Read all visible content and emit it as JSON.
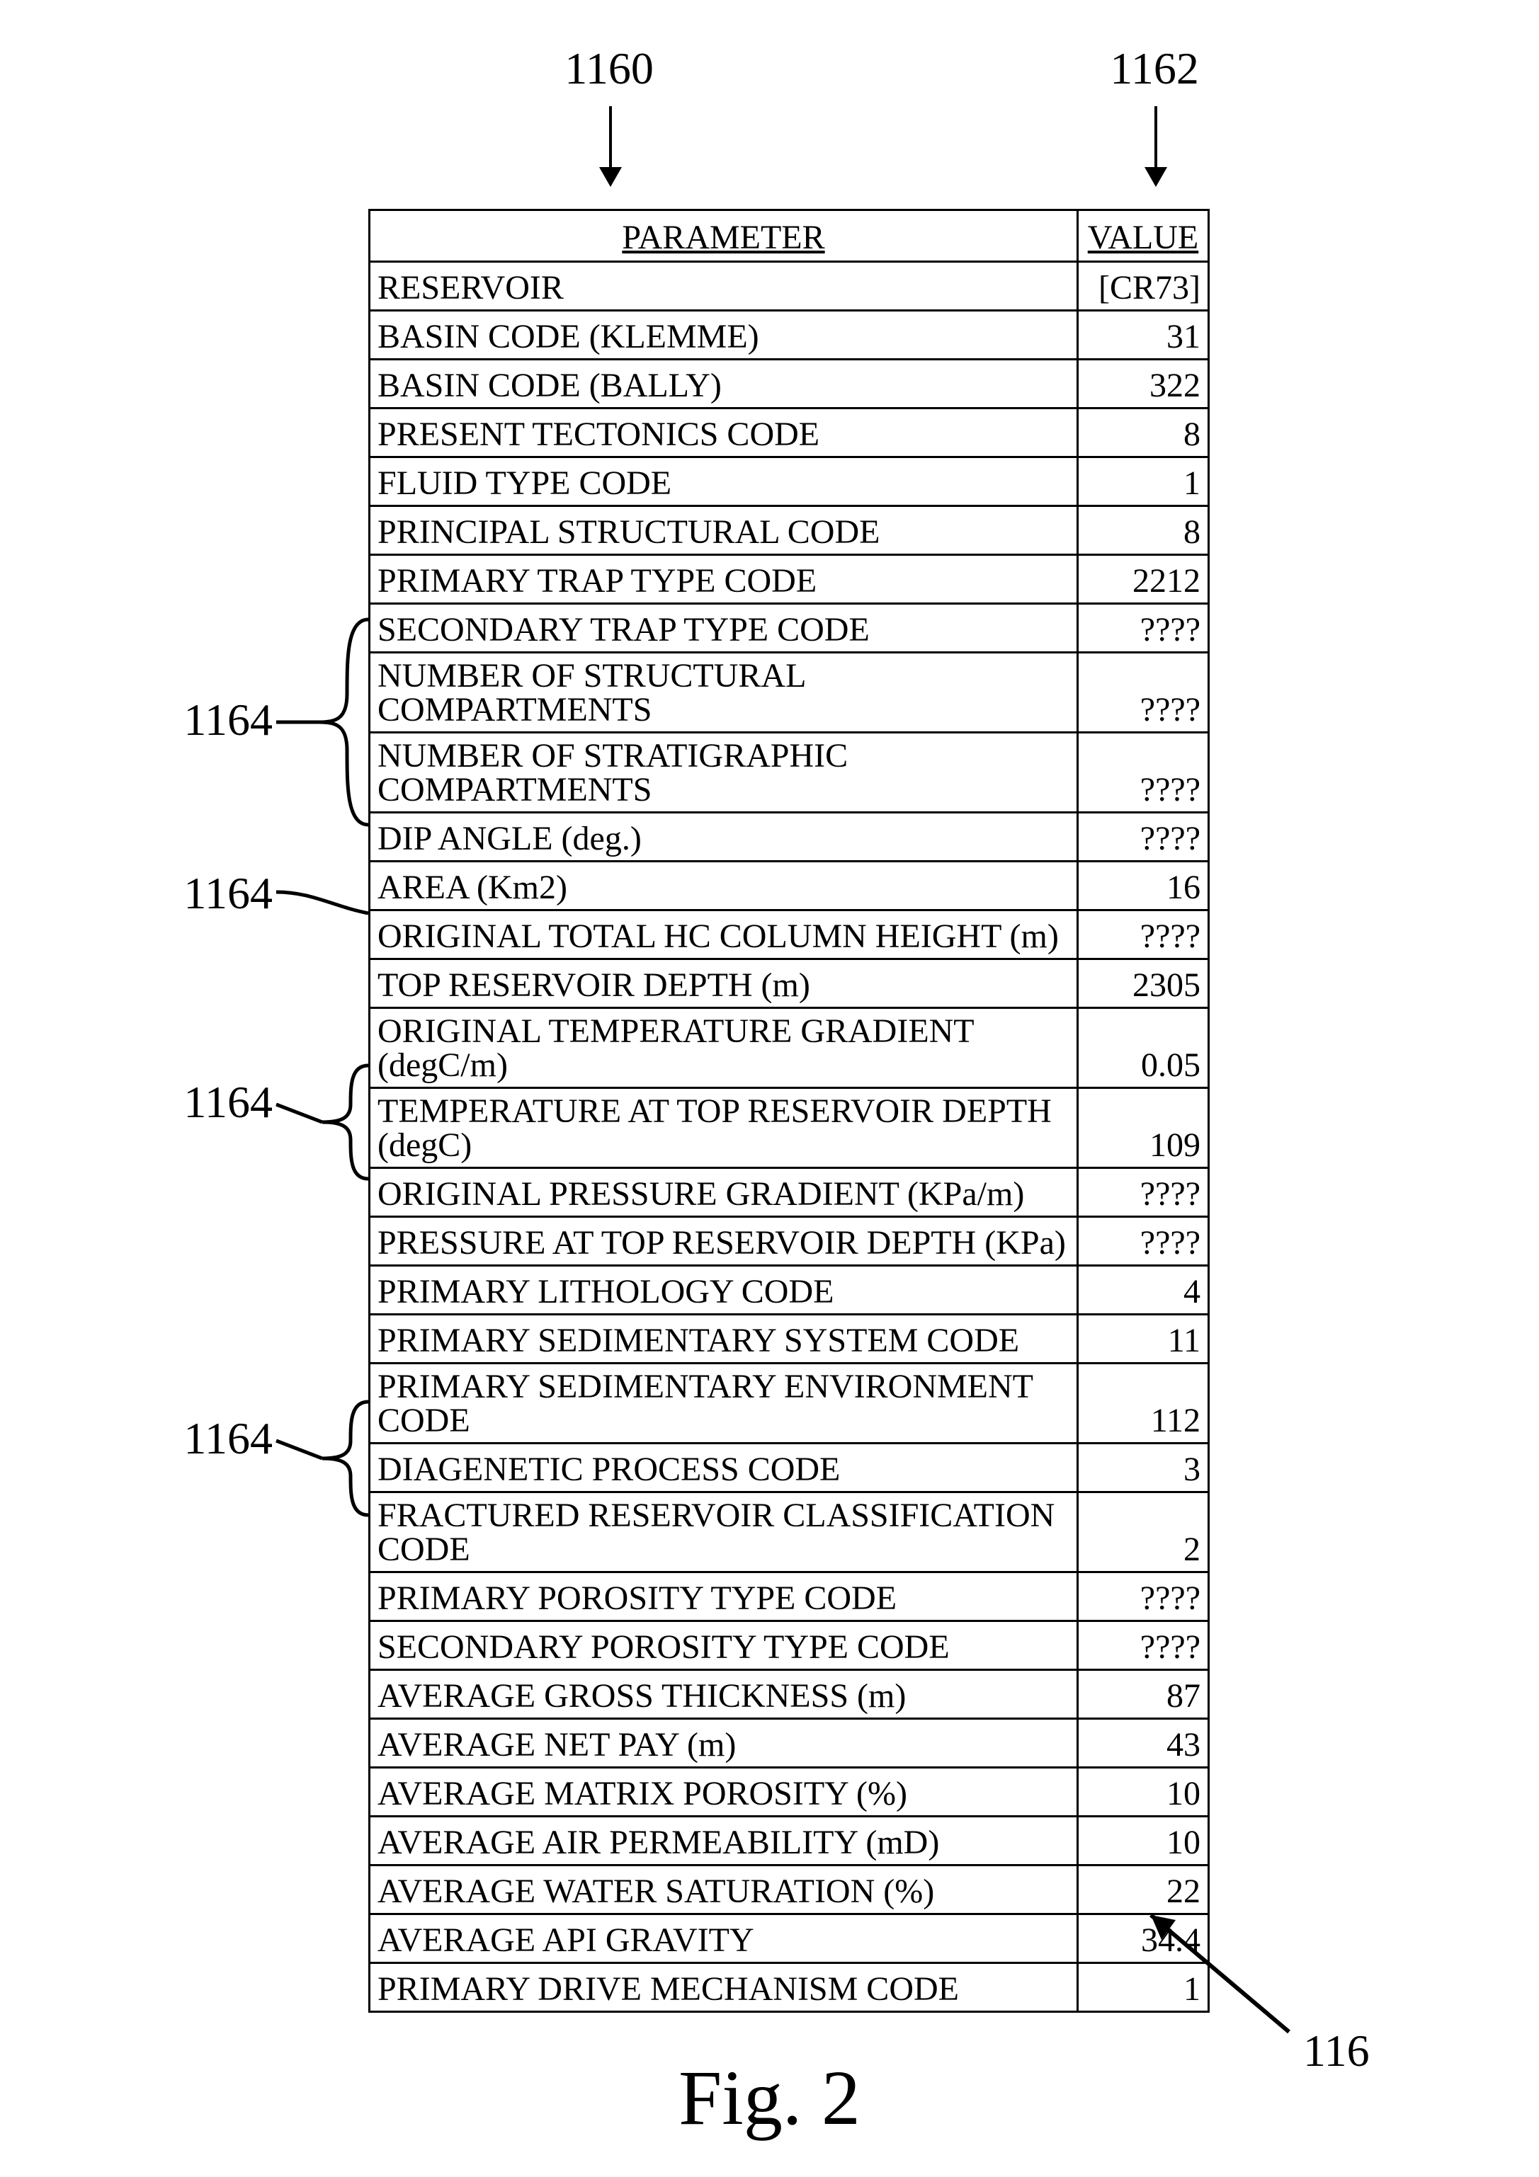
{
  "labels": {
    "col_param_pointer": "1160",
    "col_value_pointer": "1162",
    "row_pointer": "1164",
    "figure_pointer": "116",
    "figure_caption": "Fig. 2"
  },
  "headers": {
    "parameter": "PARAMETER",
    "value": "VALUE"
  },
  "rows": [
    {
      "parameter": "RESERVOIR",
      "value": "[CR73]"
    },
    {
      "parameter": "BASIN CODE (KLEMME)",
      "value": "31"
    },
    {
      "parameter": "BASIN CODE (BALLY)",
      "value": "322"
    },
    {
      "parameter": "PRESENT TECTONICS CODE",
      "value": "8"
    },
    {
      "parameter": "FLUID TYPE CODE",
      "value": "1"
    },
    {
      "parameter": "PRINCIPAL STRUCTURAL CODE",
      "value": "8"
    },
    {
      "parameter": "PRIMARY TRAP TYPE CODE",
      "value": "2212"
    },
    {
      "parameter": "SECONDARY TRAP TYPE CODE",
      "value": "????"
    },
    {
      "parameter": "NUMBER OF STRUCTURAL COMPARTMENTS",
      "value": "????"
    },
    {
      "parameter": "NUMBER OF STRATIGRAPHIC COMPARTMENTS",
      "value": "????"
    },
    {
      "parameter": "DIP ANGLE (deg.)",
      "value": "????"
    },
    {
      "parameter": "AREA (Km2)",
      "value": "16"
    },
    {
      "parameter": "ORIGINAL TOTAL HC COLUMN HEIGHT (m)",
      "value": "????"
    },
    {
      "parameter": "TOP RESERVOIR DEPTH (m)",
      "value": "2305"
    },
    {
      "parameter": "ORIGINAL TEMPERATURE GRADIENT (degC/m)",
      "value": "0.05"
    },
    {
      "parameter": "TEMPERATURE AT TOP RESERVOIR DEPTH (degC)",
      "value": "109"
    },
    {
      "parameter": "ORIGINAL PRESSURE GRADIENT (KPa/m)",
      "value": "????"
    },
    {
      "parameter": "PRESSURE AT TOP RESERVOIR DEPTH (KPa)",
      "value": "????"
    },
    {
      "parameter": "PRIMARY LITHOLOGY CODE",
      "value": "4"
    },
    {
      "parameter": "PRIMARY SEDIMENTARY SYSTEM CODE",
      "value": "11"
    },
    {
      "parameter": "PRIMARY SEDIMENTARY ENVIRONMENT CODE",
      "value": "112"
    },
    {
      "parameter": "DIAGENETIC PROCESS CODE",
      "value": "3"
    },
    {
      "parameter": "FRACTURED RESERVOIR CLASSIFICATION CODE",
      "value": "2"
    },
    {
      "parameter": "PRIMARY POROSITY TYPE CODE",
      "value": "????"
    },
    {
      "parameter": "SECONDARY POROSITY TYPE CODE",
      "value": "????"
    },
    {
      "parameter": "AVERAGE GROSS THICKNESS (m)",
      "value": "87"
    },
    {
      "parameter": "AVERAGE NET PAY (m)",
      "value": "43"
    },
    {
      "parameter": "AVERAGE MATRIX POROSITY (%)",
      "value": "10"
    },
    {
      "parameter": "AVERAGE AIR PERMEABILITY (mD)",
      "value": "10"
    },
    {
      "parameter": "AVERAGE WATER SATURATION (%)",
      "value": "22"
    },
    {
      "parameter": "AVERAGE API GRAVITY",
      "value": "34.4"
    },
    {
      "parameter": "PRIMARY DRIVE MECHANISM CODE",
      "value": "1"
    }
  ]
}
